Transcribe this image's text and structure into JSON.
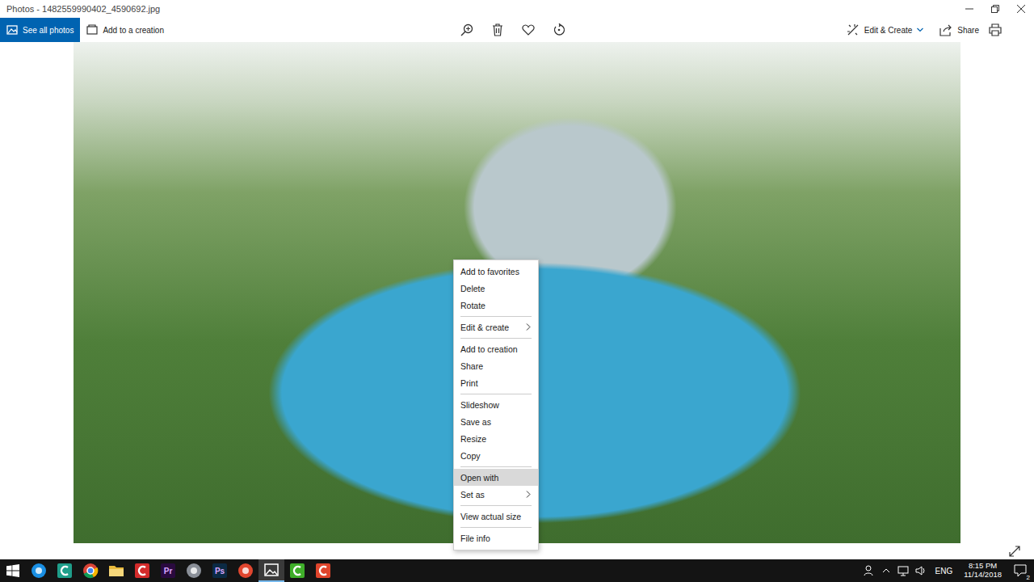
{
  "window": {
    "title": "Photos - 1482559990402_4590692.jpg"
  },
  "toolbar": {
    "left": [
      {
        "label": "See all photos",
        "kind": "gallery",
        "selected": true
      },
      {
        "label": "Add to a creation",
        "kind": "creation",
        "selected": false
      }
    ],
    "right": [
      {
        "label": "Edit & Create",
        "kind": "edit"
      },
      {
        "label": "Share",
        "kind": "share"
      }
    ]
  },
  "context_menu": {
    "items": [
      {
        "label": "Add to favorites",
        "hovered": false,
        "submenu": false,
        "separator_after": false
      },
      {
        "label": "Delete",
        "hovered": false,
        "submenu": false,
        "separator_after": false
      },
      {
        "label": "Rotate",
        "hovered": false,
        "submenu": false,
        "separator_after": true
      },
      {
        "label": "Edit & create",
        "hovered": false,
        "submenu": true,
        "separator_after": true
      },
      {
        "label": "Add to creation",
        "hovered": false,
        "submenu": false,
        "separator_after": false
      },
      {
        "label": "Share",
        "hovered": false,
        "submenu": false,
        "separator_after": false
      },
      {
        "label": "Print",
        "hovered": false,
        "submenu": false,
        "separator_after": true
      },
      {
        "label": "Slideshow",
        "hovered": false,
        "submenu": false,
        "separator_after": false
      },
      {
        "label": "Save as",
        "hovered": false,
        "submenu": false,
        "separator_after": false
      },
      {
        "label": "Resize",
        "hovered": false,
        "submenu": false,
        "separator_after": false
      },
      {
        "label": "Copy",
        "hovered": false,
        "submenu": false,
        "separator_after": true
      },
      {
        "label": "Open with",
        "hovered": true,
        "submenu": false,
        "separator_after": false
      },
      {
        "label": "Set as",
        "hovered": false,
        "submenu": true,
        "separator_after": true
      },
      {
        "label": "View actual size",
        "hovered": false,
        "submenu": false,
        "separator_after": true
      },
      {
        "label": "File info",
        "hovered": false,
        "submenu": false,
        "separator_after": false
      }
    ]
  },
  "taskbar": {
    "apps": [
      {
        "kind": "circle",
        "label": "",
        "color": "#1a8fe3",
        "active": false
      },
      {
        "kind": "tile",
        "label": "",
        "color": "#1f9e8a",
        "active": false
      },
      {
        "kind": "chrome",
        "label": "",
        "color": "#db4437",
        "active": false
      },
      {
        "kind": "folder",
        "label": "",
        "color": "#e8b93c",
        "active": false
      },
      {
        "kind": "tile",
        "label": "",
        "color": "#d42b2b",
        "active": false
      },
      {
        "kind": "letter",
        "label": "Pr",
        "color": "#2a0a3f",
        "active": false
      },
      {
        "kind": "circle",
        "label": "",
        "color": "#8a8f98",
        "active": false
      },
      {
        "kind": "letter",
        "label": "Ps",
        "color": "#0b2a44",
        "active": false
      },
      {
        "kind": "circle",
        "label": "",
        "color": "#e0462f",
        "active": false
      },
      {
        "kind": "photos",
        "label": "",
        "color": "#ffffff",
        "active": true
      },
      {
        "kind": "tile",
        "label": "",
        "color": "#3fae2a",
        "active": false
      },
      {
        "kind": "tile",
        "label": "",
        "color": "#e0452c",
        "active": false
      }
    ],
    "language": "ENG",
    "time": "8:15 PM",
    "date": "11/14/2018",
    "notifications": "2"
  }
}
